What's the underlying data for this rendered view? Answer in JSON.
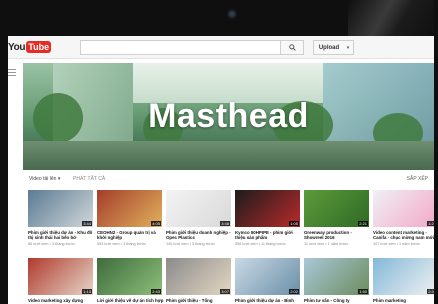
{
  "browser": {
    "camera": "webcam-dot"
  },
  "header": {
    "logo_you": "You",
    "logo_tube": "Tube",
    "search_placeholder": "",
    "search_icon": "search-icon",
    "upload_label": "Upload",
    "upload_caret": "▾"
  },
  "masthead": {
    "title": "Masthead"
  },
  "video_bar": {
    "label": "Video tải lên ▾",
    "all": "PHÁT TẤT CẢ",
    "sort": "SẮP XẾP"
  },
  "videos_row1": [
    {
      "title": "Phim giới thiệu dự án - Khu đô thị sinh thái hai bên bờ",
      "meta": "85 lượt xem • 3 tháng trước",
      "duration": "3:44",
      "colors": [
        "#5a7b93",
        "#d1d7da"
      ]
    },
    {
      "title": "CEOHN2 - Group quản trị và khởi nghiệp",
      "meta": "553 lượt xem • 3 tháng trước",
      "duration": "4:05",
      "colors": [
        "#a53d2b",
        "#e0b15c"
      ]
    },
    {
      "title": "Phim giới thiệu doanh nghiệp - Opec Plastics",
      "meta": "145 lượt xem • 3 tháng trước",
      "duration": "3:48",
      "colors": [
        "#f3f3f3",
        "#d9d9d9"
      ]
    },
    {
      "title": "Kymco 50HPIPE - phim giới thiệu sản phẩm",
      "meta": "356 lượt xem • 11 tháng trước",
      "duration": "1:05",
      "colors": [
        "#1c1c1c",
        "#b82a2a"
      ]
    },
    {
      "title": "Greenway production - Showreel 2016",
      "meta": "11 lượt xem • 1 năm trước",
      "duration": "2:21",
      "colors": [
        "#5d9b3b",
        "#2f6a25"
      ]
    },
    {
      "title": "Video content marketing - Canifa - chục mừng nam mới",
      "meta": "107 lượt xem • 1 năm trước",
      "duration": "1:22",
      "colors": [
        "#f0f0f5",
        "#f2a7c6"
      ]
    }
  ],
  "videos_row2": [
    {
      "title": "Video marketing xây dựng",
      "meta": "",
      "duration": "1:13",
      "colors": [
        "#b03a2e",
        "#e6d6c8"
      ]
    },
    {
      "title": "Lời giới thiệu về dự án tích hợp",
      "meta": "",
      "duration": "2:43",
      "colors": [
        "#3f6b3c",
        "#8dbf7a"
      ]
    },
    {
      "title": "Phim giới thiệu - Tổng",
      "meta": "",
      "duration": "3:07",
      "colors": [
        "#8b8b8b",
        "#e4d7c3"
      ]
    },
    {
      "title": "Phim giới thiệu dự án - Bình",
      "meta": "",
      "duration": "2:02",
      "colors": [
        "#c9d9e6",
        "#6a8fa7"
      ]
    },
    {
      "title": "Phim tư vấn - Công ty",
      "meta": "",
      "duration": "1:50",
      "colors": [
        "#a8c8d8",
        "#6c8c5e"
      ]
    },
    {
      "title": "Phim marketing",
      "meta": "",
      "duration": "2:31",
      "colors": [
        "#83b8d8",
        "#f2f2f2"
      ]
    }
  ],
  "sidebar": {
    "menu_icon": "hamburger-menu-icon"
  }
}
